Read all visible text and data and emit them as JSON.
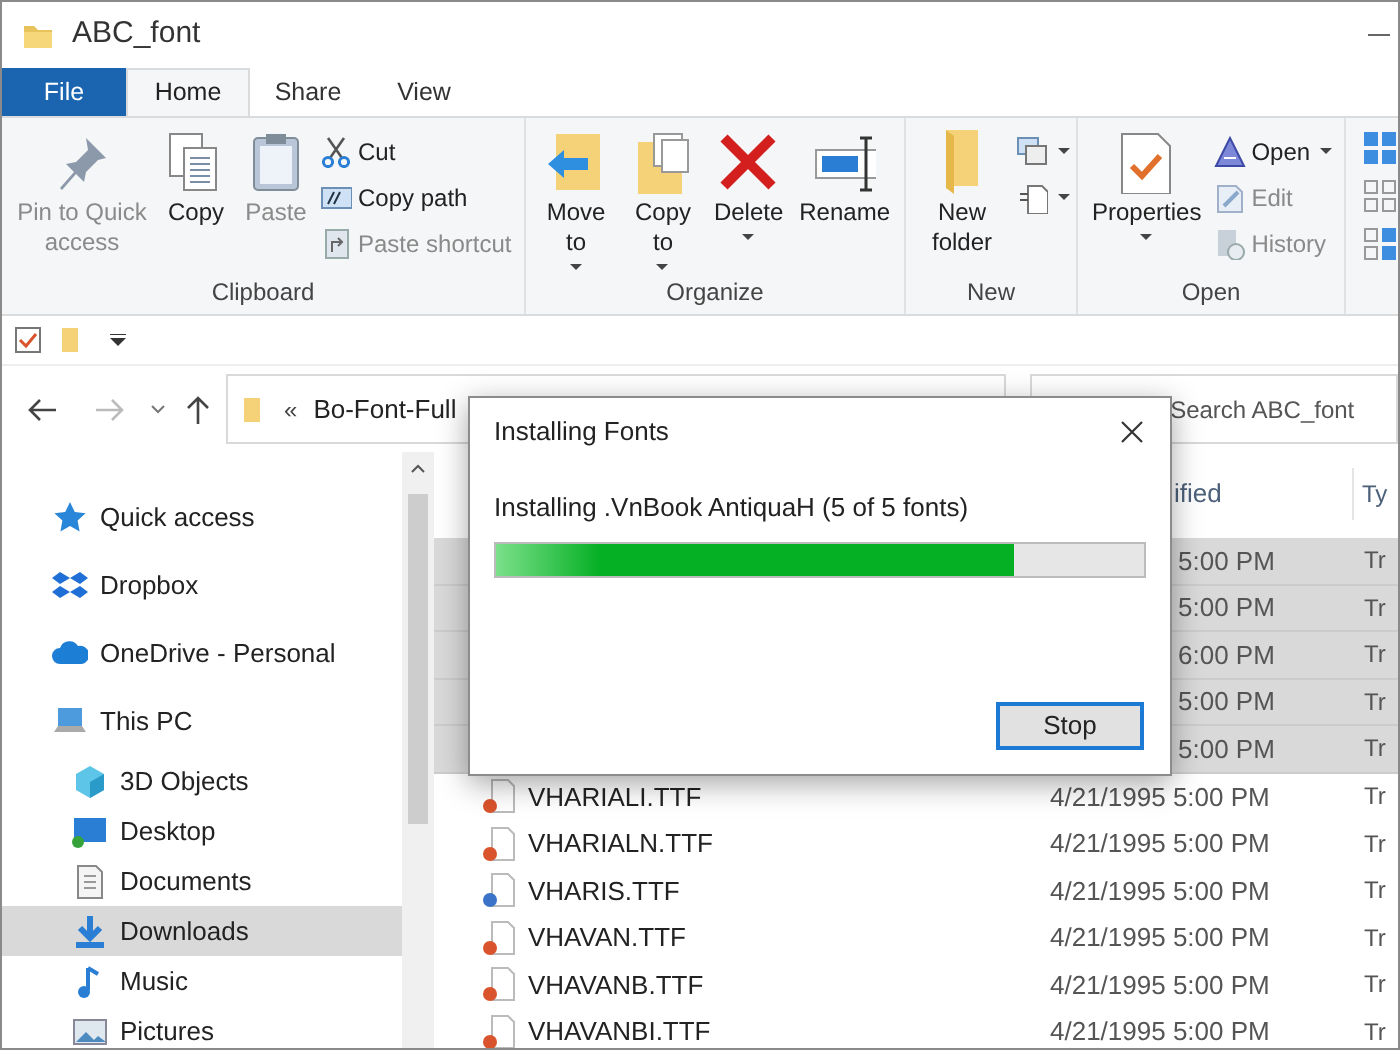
{
  "window": {
    "title": "ABC_font"
  },
  "file_menu": {
    "label": "File"
  },
  "tabs": [
    {
      "label": "Home",
      "selected": true
    },
    {
      "label": "Share",
      "selected": false
    },
    {
      "label": "View",
      "selected": false
    }
  ],
  "ribbon": [
    {
      "label": "Clipboard",
      "large": [
        {
          "label": "Pin to Quick access",
          "disabled": true,
          "dropdown": false
        },
        {
          "label": "Copy",
          "disabled": false,
          "dropdown": false
        },
        {
          "label": "Paste",
          "disabled": true,
          "dropdown": false
        }
      ],
      "small": [
        {
          "label": "Cut",
          "disabled": false,
          "dropdown": false
        },
        {
          "label": "Copy path",
          "disabled": false,
          "dropdown": false
        },
        {
          "label": "Paste shortcut",
          "disabled": true,
          "dropdown": false
        }
      ]
    },
    {
      "label": "Organize",
      "large": [
        {
          "label": "Move to",
          "disabled": false,
          "dropdown": true
        },
        {
          "label": "Copy to",
          "disabled": false,
          "dropdown": true
        },
        {
          "label": "Delete",
          "disabled": false,
          "dropdown": true
        },
        {
          "label": "Rename",
          "disabled": false,
          "dropdown": false
        }
      ]
    },
    {
      "label": "New",
      "large": [
        {
          "label": "New folder",
          "disabled": false,
          "dropdown": false
        }
      ],
      "small": [
        {
          "dropdown": true
        },
        {
          "dropdown": true
        }
      ]
    },
    {
      "label": "Open",
      "large": [
        {
          "label": "Properties",
          "disabled": false,
          "dropdown": true
        }
      ],
      "small": [
        {
          "label": "Open",
          "disabled": false,
          "dropdown": true
        },
        {
          "label": "Edit",
          "disabled": true,
          "dropdown": false
        },
        {
          "label": "History",
          "disabled": true,
          "dropdown": false
        }
      ]
    }
  ],
  "address": {
    "path": "Bo-Font-Full",
    "overflow": "«"
  },
  "search": {
    "placeholder": "Search ABC_font"
  },
  "nav": [
    {
      "label": "Quick access",
      "selected": false
    },
    {
      "label": "Dropbox",
      "selected": false
    },
    {
      "label": "OneDrive - Personal",
      "selected": false
    },
    {
      "label": "This PC",
      "selected": false,
      "children": [
        {
          "label": "3D Objects",
          "selected": false
        },
        {
          "label": "Desktop",
          "selected": false
        },
        {
          "label": "Documents",
          "selected": false
        },
        {
          "label": "Downloads",
          "selected": true
        },
        {
          "label": "Music",
          "selected": false
        },
        {
          "label": "Pictures",
          "selected": false
        }
      ]
    }
  ],
  "columns": [
    {
      "label": "ified"
    },
    {
      "label": "Ty"
    }
  ],
  "rows": [
    {
      "modified": "5:00 PM",
      "type": "Tr",
      "selected": true
    },
    {
      "modified": "5:00 PM",
      "type": "Tr",
      "selected": true
    },
    {
      "modified": "6:00 PM",
      "type": "Tr",
      "selected": true
    },
    {
      "modified": "5:00 PM",
      "type": "Tr",
      "selected": true
    },
    {
      "modified": "5:00 PM",
      "type": "Tr",
      "selected": true
    },
    {
      "name": "VHARIALI.TTF",
      "color": "#d9532c",
      "modified": "4/21/1995 5:00 PM",
      "type": "Tr",
      "selected": false
    },
    {
      "name": "VHARIALN.TTF",
      "color": "#d9532c",
      "modified": "4/21/1995 5:00 PM",
      "type": "Tr",
      "selected": false
    },
    {
      "name": "VHARIS.TTF",
      "color": "#3b73c8",
      "modified": "4/21/1995 5:00 PM",
      "type": "Tr",
      "selected": false
    },
    {
      "name": "VHAVAN.TTF",
      "color": "#d9532c",
      "modified": "4/21/1995 5:00 PM",
      "type": "Tr",
      "selected": false
    },
    {
      "name": "VHAVANB.TTF",
      "color": "#d9532c",
      "modified": "4/21/1995 5:00 PM",
      "type": "Tr",
      "selected": false
    },
    {
      "name": "VHAVANBI.TTF",
      "color": "#d9532c",
      "modified": "4/21/1995 5:00 PM",
      "type": "Tr",
      "selected": false
    }
  ],
  "dialog": {
    "title": "Installing Fonts",
    "message": "Installing .VnBook AntiquaH (5 of 5 fonts)",
    "level": 0.8,
    "button": "Stop"
  }
}
